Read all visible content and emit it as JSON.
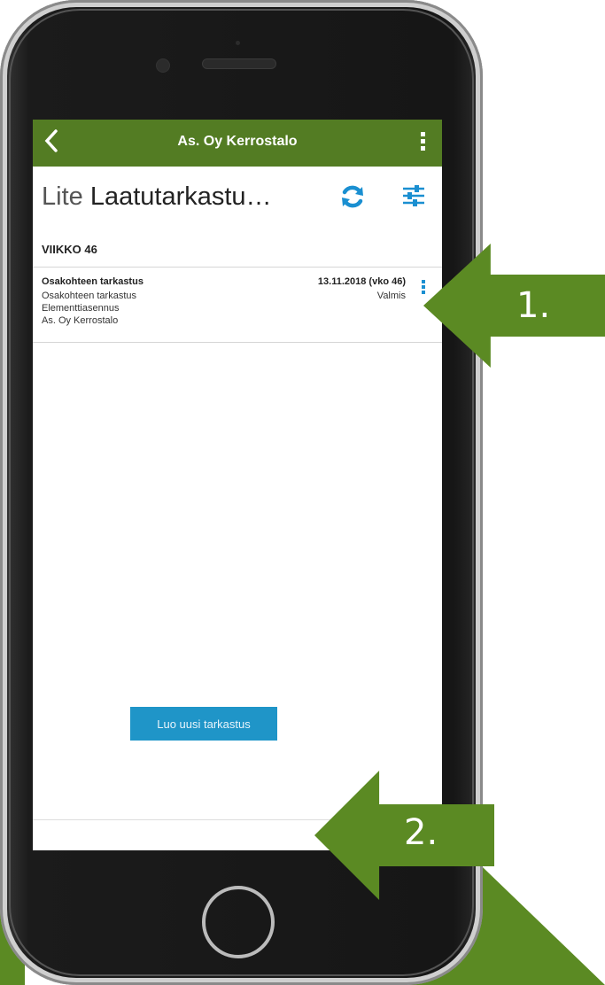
{
  "app": {
    "title": "As. Oy Kerrostalo",
    "back_icon": "chevron-left-icon",
    "menu_icon": "more-vertical-icon"
  },
  "page": {
    "heading_light": "Lite",
    "heading_bold": "Laatutarkastu…",
    "sync_icon": "refresh-icon",
    "filter_icon": "sliders-icon"
  },
  "section": {
    "label": "VIIKKO 46"
  },
  "inspections": [
    {
      "title": "Osakohteen tarkastus",
      "subtitle": "Osakohteen tarkastus",
      "phase": "Elementtiasennus",
      "site": "As. Oy Kerrostalo",
      "date": "13.11.2018 (vko 46)",
      "status": "Valmis"
    }
  ],
  "actions": {
    "new_inspection": "Luo uusi tarkastus"
  },
  "annotations": {
    "arrow1_label": "1.",
    "arrow2_label": "2."
  },
  "colors": {
    "topbar": "#537c23",
    "accent": "#1f95c8",
    "arrow": "#5b8a23"
  }
}
